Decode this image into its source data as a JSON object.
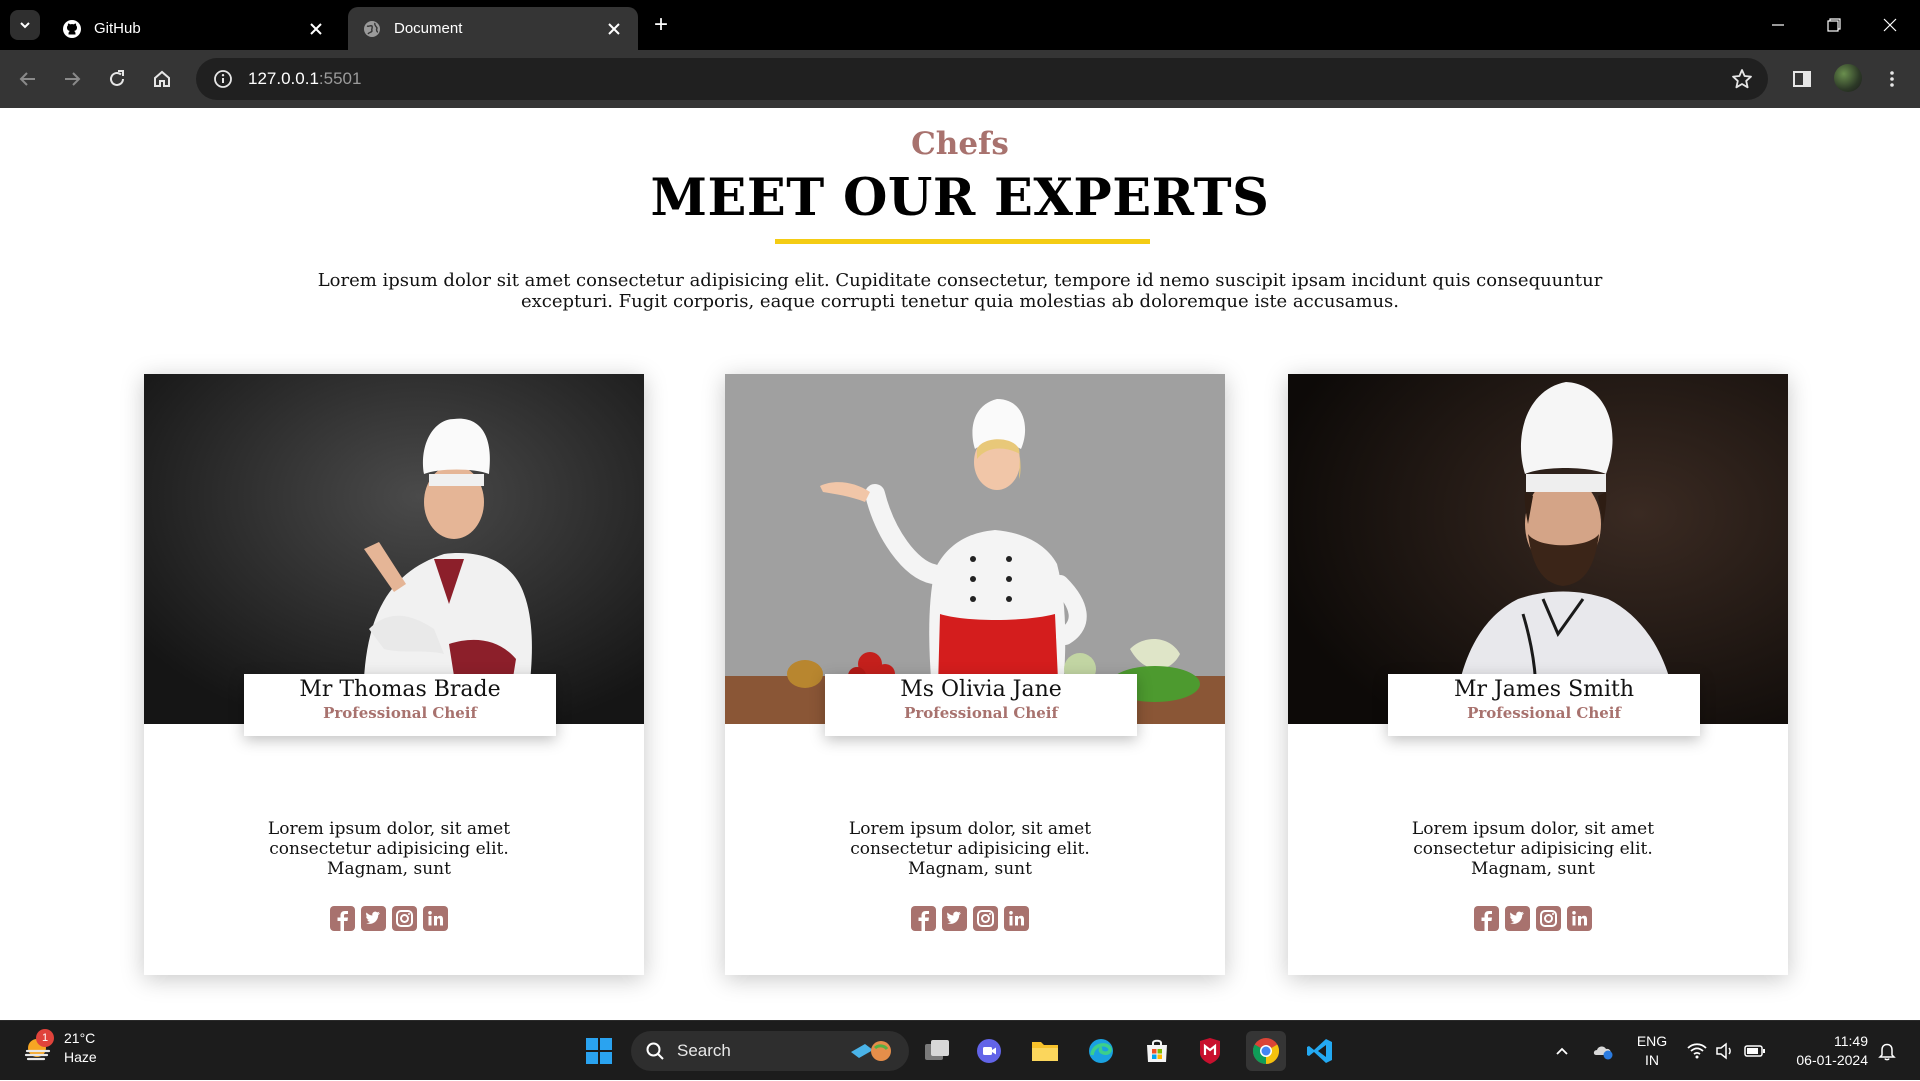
{
  "browser": {
    "tabs": [
      {
        "title": "GitHub",
        "active": false
      },
      {
        "title": "Document",
        "active": true
      }
    ],
    "url_host": "127.0.0.1",
    "url_port": ":5501"
  },
  "section": {
    "eyebrow": "Chefs",
    "heading": "MEET OUR EXPERTS",
    "intro": "Lorem ipsum dolor sit amet consectetur adipisicing elit. Cupiditate consectetur, tempore id nemo suscipit ipsam incidunt quis consequuntur excepturi. Fugit corporis, eaque corrupti tenetur quia molestias ab doloremque iste accusamus.",
    "accent_color": "#a8726e",
    "underline_color": "#f4cc14"
  },
  "chefs": [
    {
      "name": "Mr Thomas Brade",
      "role": "Professional Cheif",
      "description": "Lorem ipsum dolor, sit amet consectetur adipisicing elit. Magnam, sunt"
    },
    {
      "name": "Ms Olivia Jane",
      "role": "Professional Cheif",
      "description": "Lorem ipsum dolor, sit amet consectetur adipisicing elit. Magnam, sunt"
    },
    {
      "name": "Mr James Smith",
      "role": "Professional Cheif",
      "description": "Lorem ipsum dolor, sit amet consectetur adipisicing elit. Magnam, sunt"
    }
  ],
  "social_icons": [
    "facebook-icon",
    "twitter-icon",
    "instagram-icon",
    "linkedin-icon"
  ],
  "taskbar": {
    "weather_temp": "21°C",
    "weather_desc": "Haze",
    "weather_badge": "1",
    "search_label": "Search",
    "language": "ENG",
    "region": "IN",
    "time": "11:49",
    "date": "06-01-2024"
  }
}
